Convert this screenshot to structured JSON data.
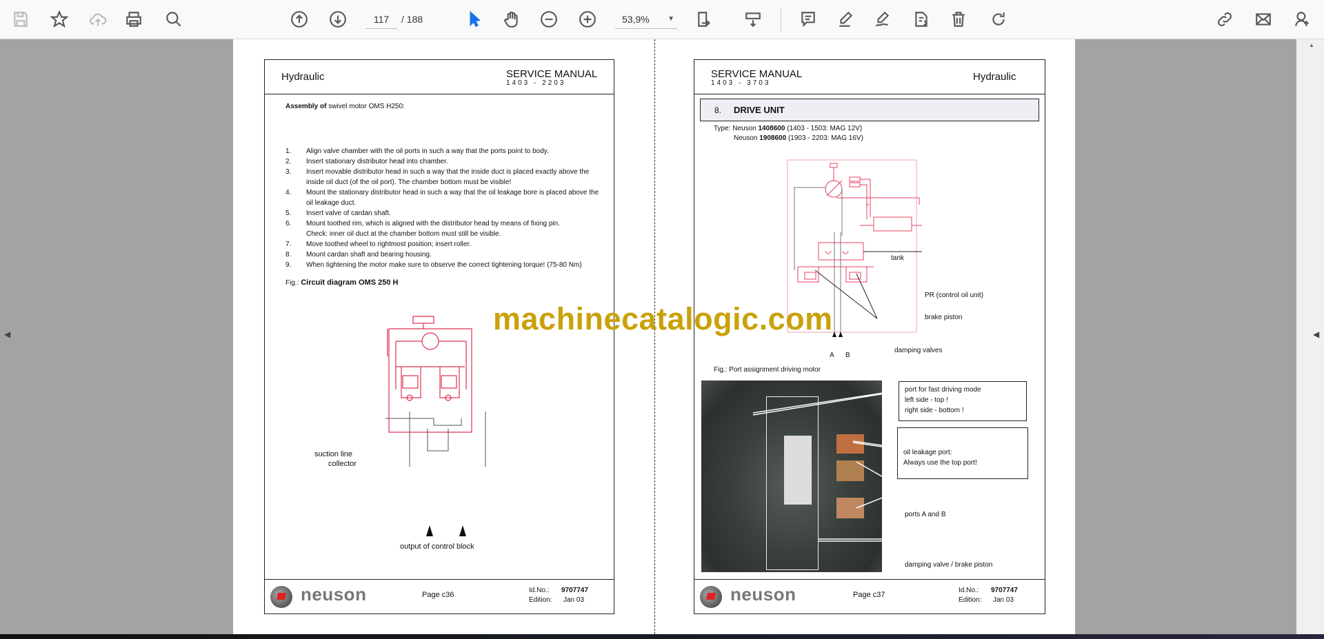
{
  "toolbar": {
    "left_icons": [
      "save-icon",
      "bookmark-star-icon",
      "upload-cloud-icon",
      "print-icon",
      "find-zoom-icon"
    ],
    "nav_icons": [
      "prev-page-icon",
      "next-page-icon"
    ],
    "current_page": "117",
    "total_pages": "/ 188",
    "tool_icons": [
      "select-cursor-icon",
      "hand-pan-icon",
      "zoom-out-icon",
      "zoom-in-icon"
    ],
    "zoom": "53,9%",
    "right_icons": [
      "fit-page-icon",
      "scroll-mode-icon",
      "comment-icon",
      "highlight-pen-icon",
      "sign-icon",
      "edit-text-icon",
      "delete-icon",
      "rotate-icon"
    ],
    "far_right_icons": [
      "share-link-icon",
      "email-icon",
      "add-user-icon"
    ],
    "accent": "#1473e6"
  },
  "watermark": "machinecatalogic.com",
  "left_page": {
    "section": "Hydraulic",
    "manual": "SERVICE MANUAL",
    "models": "1403 - 2203",
    "heading_bold": "Assembly of",
    "heading_rest": " swivel motor OMS H250:",
    "steps": [
      {
        "n": "1.",
        "lines": [
          "Align valve chamber with the oil ports in such a way that the ports point to body."
        ]
      },
      {
        "n": "2.",
        "lines": [
          "Insert stationary distributor head into chamber."
        ]
      },
      {
        "n": "3.",
        "lines": [
          "Insert movable distributor head in such a way that the inside duct is placed exactly above the",
          "inside oil duct (of the oil port). The chamber bottom must be visible!"
        ]
      },
      {
        "n": "4.",
        "lines": [
          "Mount the stationary distributor head in such a way that the oil leakage bore is placed above the",
          "oil leakage duct."
        ]
      },
      {
        "n": "5.",
        "lines": [
          "Insert valve of cardan shaft."
        ]
      },
      {
        "n": "6.",
        "lines": [
          "Mount toothed rim, which is aligned with the distributor head by means of fixing pin.",
          "Check: inner oil duct at the chamber bottom must still be visible."
        ]
      },
      {
        "n": "7.",
        "lines": [
          "Move toothed wheel to rightmost position; insert roller."
        ]
      },
      {
        "n": "8.",
        "lines": [
          "Mount cardan shaft and bearing housing."
        ]
      },
      {
        "n": "9.",
        "lines": [
          "When tightening the motor make sure to observe the correct tightening torque! (75-80 Nm)"
        ]
      }
    ],
    "fig_prefix": "Fig.:",
    "fig_title": "Circuit diagram OMS 250 H",
    "label_suction": "suction line",
    "label_collector": "collector",
    "label_output": "output of control block",
    "footer": {
      "brand": "neuson",
      "page": "Page c36",
      "id_label": "Id.No.:",
      "id": "9707747",
      "edition_label": "Edition:",
      "edition": "Jan 03"
    }
  },
  "right_page": {
    "manual": "SERVICE MANUAL",
    "models": "1403 - 3703",
    "section": "Hydraulic",
    "chapter_num": "8.",
    "chapter_title": "DRIVE UNIT",
    "type_label": "Type:",
    "types": [
      {
        "prefix": "Neuson ",
        "code": "1408600",
        "desc": " (1403 - 1503: MAG 12V)"
      },
      {
        "prefix": "Neuson ",
        "code": "1908600",
        "desc": " (1903 - 2203: MAG 16V)"
      }
    ],
    "diagram_labels": {
      "tank": "tank",
      "pr": "PR (control oil unit)",
      "brake": "brake piston",
      "damping": "damping valves",
      "a": "A",
      "b": "B"
    },
    "fig_caption": "Fig.: Port assignment driving motor",
    "callouts": {
      "fast": [
        "port for fast driving mode",
        "left side - top !",
        "right side - bottom !"
      ],
      "leak": [
        "oil leakage port:",
        "Always use the top port!"
      ],
      "ports": "ports A and B",
      "damping": "damping valve / brake piston"
    },
    "footer": {
      "brand": "neuson",
      "page": "Page c37",
      "id_label": "Id.No.:",
      "id": "9707747",
      "edition_label": "Edition:",
      "edition": "Jan 03"
    }
  }
}
